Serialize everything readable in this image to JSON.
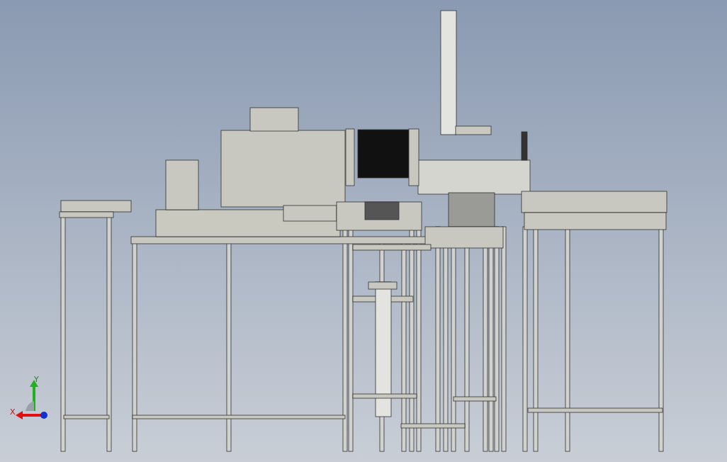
{
  "viewport": {
    "axes": [
      {
        "label": "Y"
      },
      {
        "label": "X"
      }
    ]
  }
}
